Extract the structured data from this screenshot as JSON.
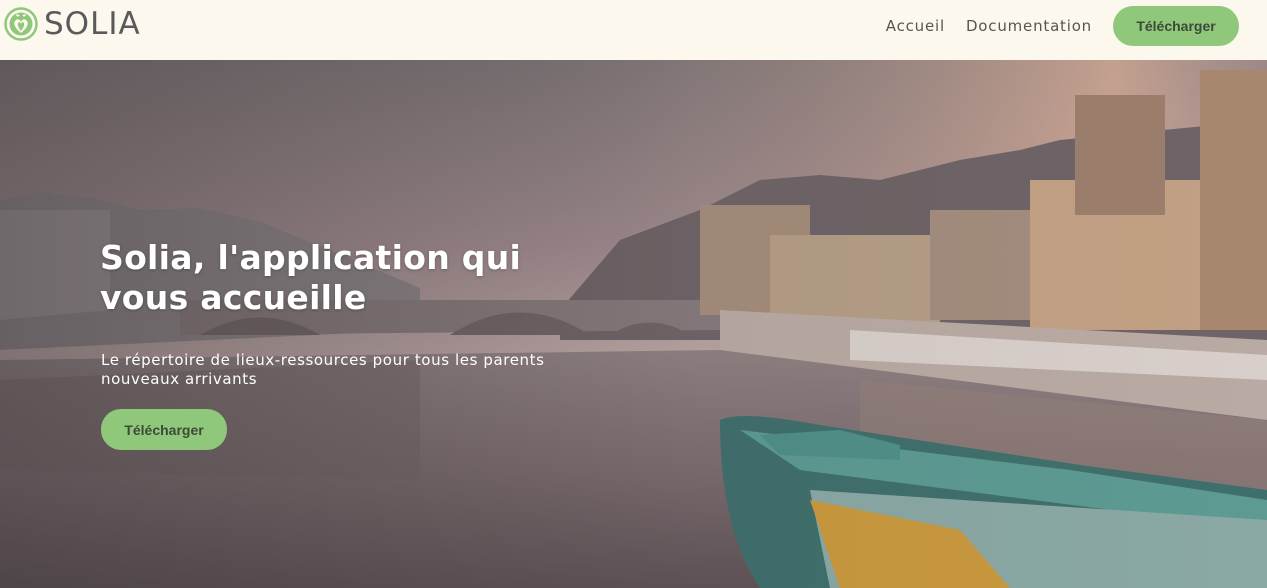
{
  "brand": {
    "name": "SOLIA",
    "logo_icon": "heart-leaf-logo-icon",
    "logo_color": "#8fc77b"
  },
  "nav": {
    "items": [
      "Accueil",
      "Documentation"
    ],
    "cta_label": "Télécharger"
  },
  "hero": {
    "title": "Solia, l'application qui vous accueille",
    "subtitle": "Le répertoire de lieux-ressources pour tous les parents nouveaux arrivants",
    "cta_label": "Télécharger",
    "background": "city-river-sunset-photo"
  },
  "colors": {
    "accent": "#8fc77b",
    "header_bg": "#fdf8ee",
    "button_text": "#3d4a38"
  }
}
